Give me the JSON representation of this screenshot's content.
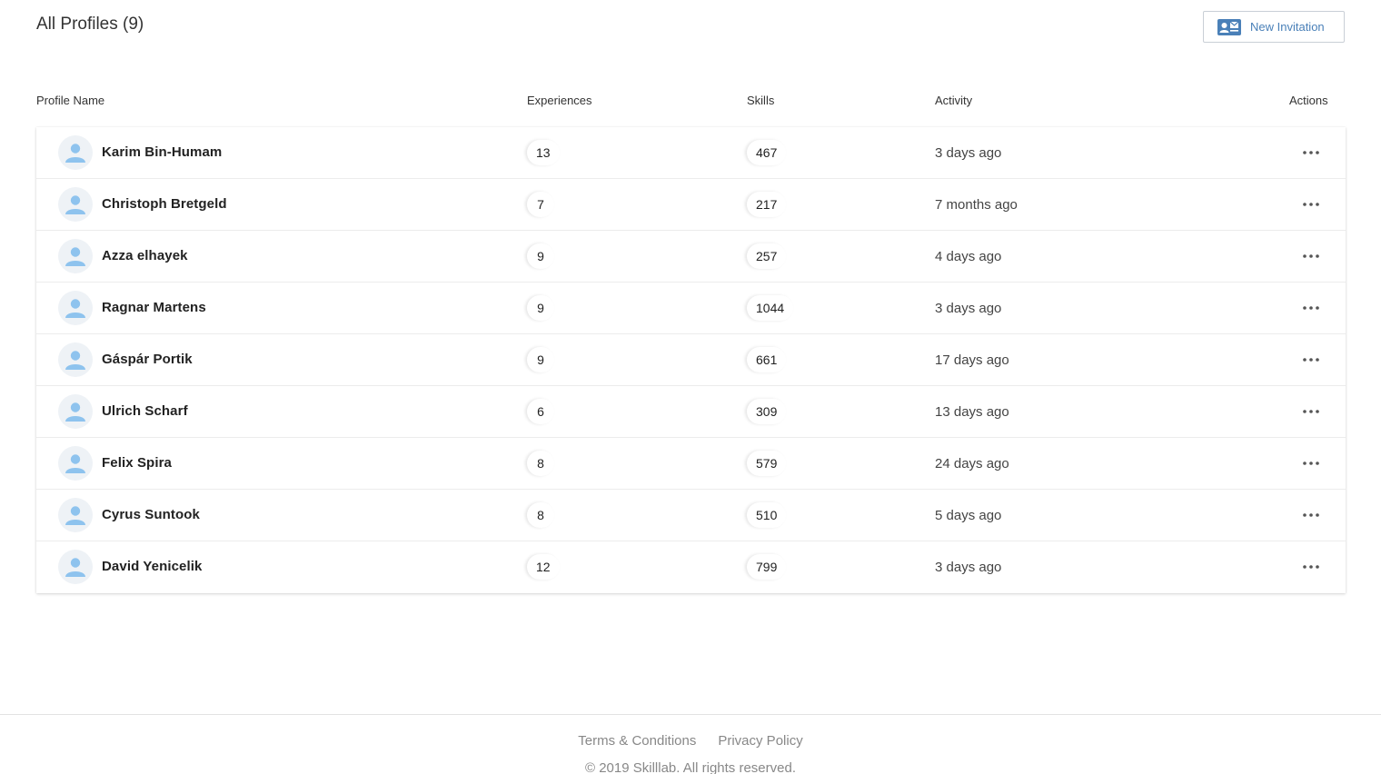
{
  "header": {
    "title": "All Profiles (9)",
    "new_invitation_label": "New Invitation",
    "new_invitation_icon": "contact-card-mail-icon"
  },
  "columns": {
    "profile_name": "Profile Name",
    "experiences": "Experiences",
    "skills": "Skills",
    "activity": "Activity",
    "actions": "Actions"
  },
  "profiles": [
    {
      "name": "Karim Bin-Humam",
      "experiences": "13",
      "skills": "467",
      "activity": "3 days ago"
    },
    {
      "name": "Christoph Bretgeld",
      "experiences": "7",
      "skills": "217",
      "activity": "7 months ago"
    },
    {
      "name": "Azza elhayek",
      "experiences": "9",
      "skills": "257",
      "activity": "4 days ago"
    },
    {
      "name": "Ragnar Martens",
      "experiences": "9",
      "skills": "1044",
      "activity": "3 days ago"
    },
    {
      "name": "Gáspár Portik",
      "experiences": "9",
      "skills": "661",
      "activity": "17 days ago"
    },
    {
      "name": "Ulrich Scharf",
      "experiences": "6",
      "skills": "309",
      "activity": "13 days ago"
    },
    {
      "name": "Felix Spira",
      "experiences": "8",
      "skills": "579",
      "activity": "24 days ago"
    },
    {
      "name": "Cyrus Suntook",
      "experiences": "8",
      "skills": "510",
      "activity": "5 days ago"
    },
    {
      "name": "David Yenicelik",
      "experiences": "12",
      "skills": "799",
      "activity": "3 days ago"
    }
  ],
  "footer": {
    "terms": "Terms & Conditions",
    "privacy": "Privacy Policy",
    "copyright": "© 2019 Skilllab. All rights reserved."
  },
  "colors": {
    "accent": "#4a80b8",
    "avatar_icon": "#8ec3ee",
    "avatar_bg": "#eef2f6"
  }
}
